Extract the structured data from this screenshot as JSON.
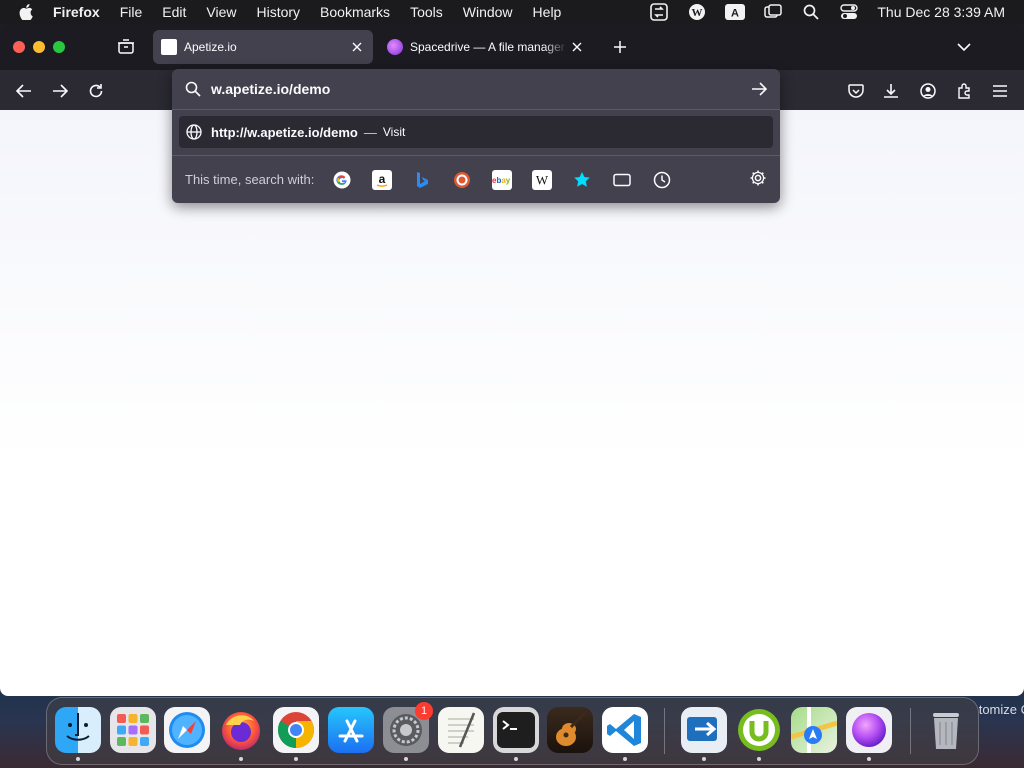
{
  "menubar": {
    "app_name": "Firefox",
    "items": [
      "File",
      "Edit",
      "View",
      "History",
      "Bookmarks",
      "Tools",
      "Window",
      "Help"
    ],
    "clock": "Thu Dec 28  3:39 AM",
    "status_icons": [
      "sync-icon",
      "wordpress-icon",
      "input-source-icon",
      "screen-mirroring-icon",
      "spotlight-icon",
      "control-center-icon"
    ]
  },
  "tabs": [
    {
      "title": "Apetize.io",
      "active": true
    },
    {
      "title": "Spacedrive — A file manager from the future",
      "active": false
    }
  ],
  "urlbar": {
    "value": "w.apetize.io/demo",
    "result_url": "http://w.apetize.io/demo",
    "result_separator": "—",
    "result_action": "Visit",
    "search_with_label": "This time, search with:",
    "engines": [
      "google",
      "amazon",
      "bing",
      "duckduckgo",
      "ebay",
      "wikipedia",
      "bookmarks",
      "tabs",
      "history"
    ]
  },
  "dock": {
    "apps": [
      "Finder",
      "Launchpad",
      "Safari",
      "Firefox",
      "Google Chrome",
      "App Store",
      "System Settings",
      "TextEdit",
      "Terminal",
      "GarageBand",
      "Visual Studio Code",
      "Migration Assistant",
      "uTorrent",
      "Maps",
      "Spacedrive",
      "Trash"
    ],
    "settings_badge": "1"
  },
  "background": {
    "partial_text": "tomize C"
  },
  "colors": {
    "tab_active": "#42414d",
    "urlbar_bg": "#42414d",
    "menubar_bg": "#1b1b1d"
  }
}
